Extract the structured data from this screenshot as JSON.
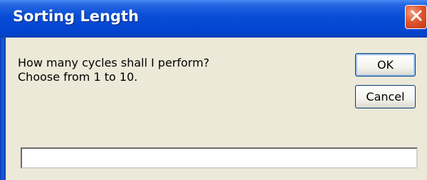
{
  "window": {
    "title": "Sorting Length"
  },
  "titlebar_colors": {
    "accent": "#0346d2",
    "close_button": "#e0562f"
  },
  "dialog": {
    "prompt_line_1": "How many cycles shall I perform?",
    "prompt_line_2": "Choose from 1 to 10.",
    "ok_label": "OK",
    "cancel_label": "Cancel",
    "input_value": ""
  },
  "icons": {
    "close": "close-icon"
  }
}
